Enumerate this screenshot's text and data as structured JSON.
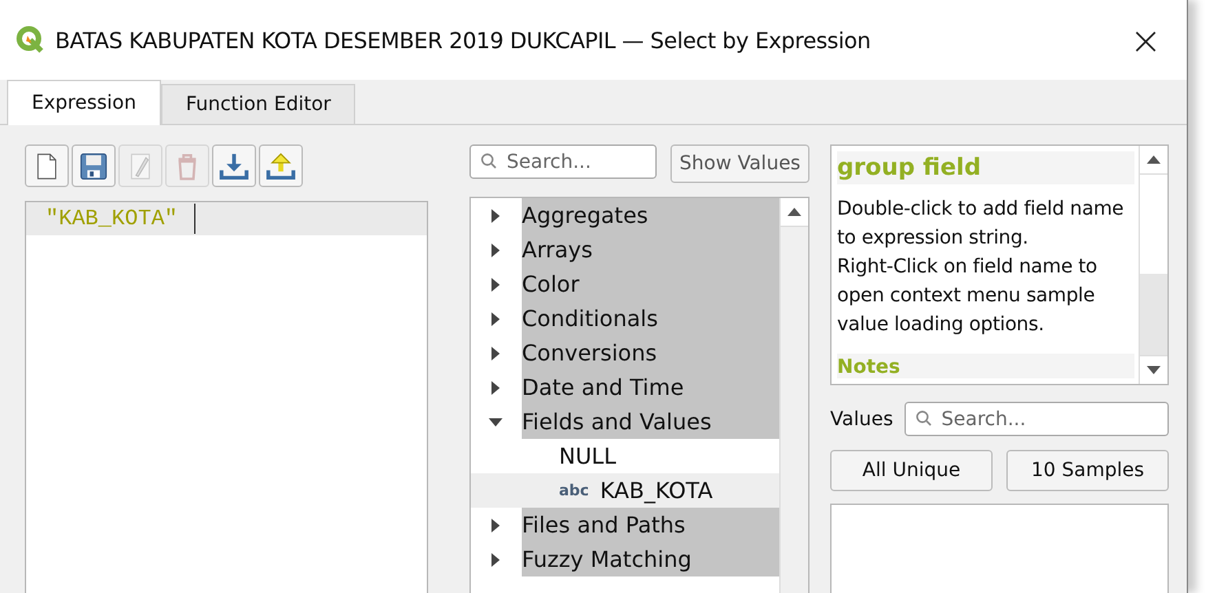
{
  "window": {
    "title": "BATAS KABUPATEN KOTA DESEMBER 2019 DUKCAPIL — Select by Expression",
    "close": "×"
  },
  "tabs": [
    {
      "label": "Expression",
      "selected": true
    },
    {
      "label": "Function Editor",
      "selected": false
    }
  ],
  "toolbar": [
    {
      "kind": "new",
      "disabled": false
    },
    {
      "kind": "save",
      "disabled": false
    },
    {
      "kind": "edit",
      "disabled": true
    },
    {
      "kind": "delete",
      "disabled": true
    },
    {
      "kind": "import",
      "disabled": false
    },
    {
      "kind": "export",
      "disabled": false
    }
  ],
  "editor": {
    "value": "\"KAB_KOTA\""
  },
  "function_search": {
    "placeholder": "Search..."
  },
  "show_values_button": "Show Values",
  "tree": [
    {
      "label": "Aggregates",
      "expanded": false
    },
    {
      "label": "Arrays",
      "expanded": false
    },
    {
      "label": "Color",
      "expanded": false
    },
    {
      "label": "Conditionals",
      "expanded": false
    },
    {
      "label": "Conversions",
      "expanded": false
    },
    {
      "label": "Date and Time",
      "expanded": false
    },
    {
      "label": "Fields and Values",
      "expanded": true,
      "children": [
        {
          "label": "NULL",
          "kind": "value"
        },
        {
          "label": "KAB_KOTA",
          "kind": "field",
          "type_badge": "abc"
        }
      ]
    },
    {
      "label": "Files and Paths",
      "expanded": false
    },
    {
      "label": "Fuzzy Matching",
      "expanded": false
    }
  ],
  "help": {
    "title": "group field",
    "body": "Double-click to add field name to expression string.\nRight-Click on field name to open context menu sample value loading options.",
    "notes_heading": "Notes"
  },
  "values": {
    "label": "Values",
    "search_placeholder": "Search...",
    "buttons": [
      "All Unique",
      "10 Samples"
    ]
  }
}
